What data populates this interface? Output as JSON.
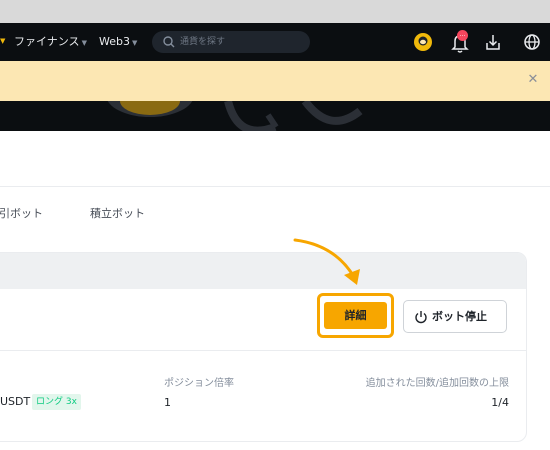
{
  "navbar": {
    "items": [
      {
        "label": "ファイナンス"
      },
      {
        "label": "Web3"
      }
    ],
    "search_placeholder": "通貨を探す",
    "notification_badge": "..."
  },
  "tabs": [
    "取引ボット",
    "積立ボット"
  ],
  "actions": {
    "detail_label": "詳細",
    "stop_label": "ボット停止"
  },
  "bot": {
    "pair": "USDT",
    "position_badge": "ロング 3x",
    "leverage_label": "ポジション倍率",
    "leverage_value": "1",
    "count_label": "追加された回数/追加回数の上限",
    "count_value": "1/4"
  },
  "colors": {
    "accent": "#f7a600",
    "nav_bg": "#0b0e11",
    "banner_bg": "#fce7b3",
    "long_green": "#0ecb81"
  }
}
